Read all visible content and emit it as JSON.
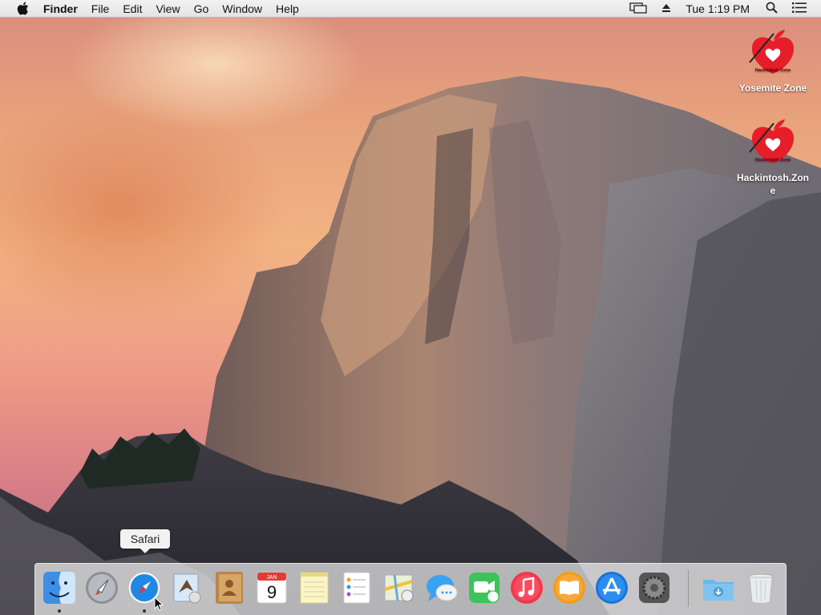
{
  "menubar": {
    "apple_icon": "apple-logo-icon",
    "menus": [
      "Finder",
      "File",
      "Edit",
      "View",
      "Go",
      "Window",
      "Help"
    ],
    "clock": "Tue 1:19 PM",
    "status_icons": [
      "display-mirroring-icon",
      "eject-icon",
      "spotlight-search-icon",
      "notification-center-icon"
    ]
  },
  "desktop_icons": [
    {
      "label": "Yosemite Zone",
      "icon": "hackintosh-zone-icon",
      "logo_text": "Hackintosh Zone"
    },
    {
      "label": "Hackintosh.Zone",
      "icon": "hackintosh-zone-icon",
      "logo_text": "Hackintosh Zone"
    }
  ],
  "tooltip": {
    "text": "Safari"
  },
  "dock": {
    "items": [
      {
        "name": "Finder",
        "icon": "finder-icon",
        "running": true
      },
      {
        "name": "Launchpad",
        "icon": "launchpad-icon",
        "running": false
      },
      {
        "name": "Safari",
        "icon": "safari-icon",
        "running": true
      },
      {
        "name": "Mail",
        "icon": "mail-icon",
        "running": false
      },
      {
        "name": "Contacts",
        "icon": "contacts-icon",
        "running": false
      },
      {
        "name": "Calendar",
        "icon": "calendar-icon",
        "running": false,
        "month": "JAN",
        "day": "9"
      },
      {
        "name": "Notes",
        "icon": "notes-icon",
        "running": false
      },
      {
        "name": "Reminders",
        "icon": "reminders-icon",
        "running": false
      },
      {
        "name": "Maps",
        "icon": "maps-icon",
        "running": false
      },
      {
        "name": "Messages",
        "icon": "messages-icon",
        "running": false
      },
      {
        "name": "FaceTime",
        "icon": "facetime-icon",
        "running": false
      },
      {
        "name": "iTunes",
        "icon": "itunes-icon",
        "running": false
      },
      {
        "name": "iBooks",
        "icon": "ibooks-icon",
        "running": false
      },
      {
        "name": "App Store",
        "icon": "app-store-icon",
        "running": false
      },
      {
        "name": "System Preferences",
        "icon": "system-preferences-icon",
        "running": false
      },
      {
        "name": "Downloads",
        "icon": "downloads-folder-icon",
        "running": false
      },
      {
        "name": "Trash",
        "icon": "trash-icon",
        "running": false
      }
    ]
  }
}
